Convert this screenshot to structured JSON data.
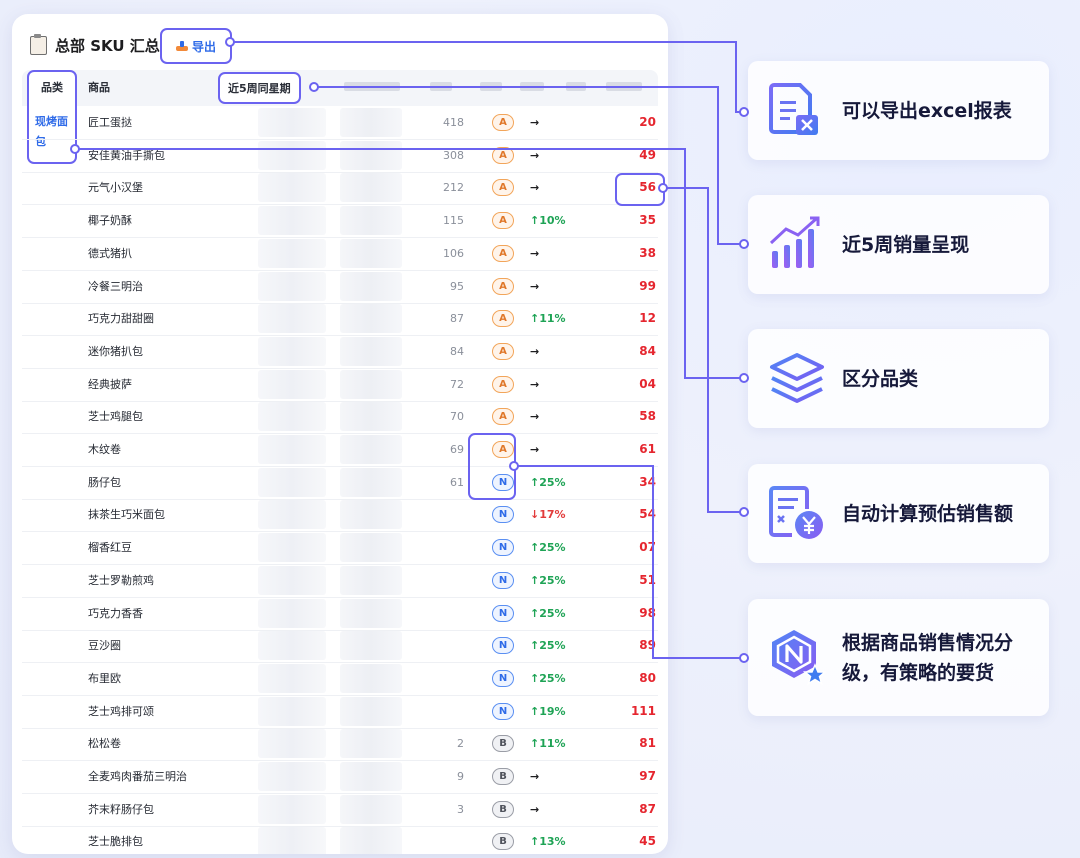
{
  "panel": {
    "title": "总部 SKU 汇总",
    "export_label": "导出",
    "headers": {
      "category": "品类",
      "product": "商品",
      "weeks": "近5周同星期"
    },
    "category_value": "现烤面包"
  },
  "rows": [
    {
      "name": "匠工蛋挞",
      "qty": "418",
      "grade": "A",
      "trend": "→",
      "trend_dir": "flat",
      "est": "20"
    },
    {
      "name": "安佳黄油手撕包",
      "qty": "308",
      "grade": "A",
      "trend": "→",
      "trend_dir": "flat",
      "est": "49"
    },
    {
      "name": "元气小汉堡",
      "qty": "212",
      "grade": "A",
      "trend": "→",
      "trend_dir": "flat",
      "est": "56"
    },
    {
      "name": "椰子奶酥",
      "qty": "115",
      "grade": "A",
      "trend": "↑10%",
      "trend_dir": "up",
      "est": "35"
    },
    {
      "name": "德式猪扒",
      "qty": "106",
      "grade": "A",
      "trend": "→",
      "trend_dir": "flat",
      "est": "38"
    },
    {
      "name": "冷餐三明治",
      "qty": "95",
      "grade": "A",
      "trend": "→",
      "trend_dir": "flat",
      "est": "99"
    },
    {
      "name": "巧克力甜甜圈",
      "qty": "87",
      "grade": "A",
      "trend": "↑11%",
      "trend_dir": "up",
      "est": "12"
    },
    {
      "name": "迷你猪扒包",
      "qty": "84",
      "grade": "A",
      "trend": "→",
      "trend_dir": "flat",
      "est": "84"
    },
    {
      "name": "经典披萨",
      "qty": "72",
      "grade": "A",
      "trend": "→",
      "trend_dir": "flat",
      "est": "04"
    },
    {
      "name": "芝士鸡腿包",
      "qty": "70",
      "grade": "A",
      "trend": "→",
      "trend_dir": "flat",
      "est": "58"
    },
    {
      "name": "木纹卷",
      "qty": "69",
      "grade": "A",
      "trend": "→",
      "trend_dir": "flat",
      "est": "61"
    },
    {
      "name": "肠仔包",
      "qty": "61",
      "grade": "N",
      "trend": "↑25%",
      "trend_dir": "up",
      "est": "34"
    },
    {
      "name": "抹茶生巧米面包",
      "qty": "",
      "grade": "N",
      "trend": "↓17%",
      "trend_dir": "down",
      "est": "54"
    },
    {
      "name": "榴香红豆",
      "qty": "",
      "grade": "N",
      "trend": "↑25%",
      "trend_dir": "up",
      "est": "07"
    },
    {
      "name": "芝士罗勒煎鸡",
      "qty": "",
      "grade": "N",
      "trend": "↑25%",
      "trend_dir": "up",
      "est": "51"
    },
    {
      "name": "巧克力香香",
      "qty": "",
      "grade": "N",
      "trend": "↑25%",
      "trend_dir": "up",
      "est": "98"
    },
    {
      "name": "豆沙圈",
      "qty": "",
      "grade": "N",
      "trend": "↑25%",
      "trend_dir": "up",
      "est": "89"
    },
    {
      "name": "布里欧",
      "qty": "",
      "grade": "N",
      "trend": "↑25%",
      "trend_dir": "up",
      "est": "80"
    },
    {
      "name": "芝士鸡排可颂",
      "qty": "",
      "grade": "N",
      "trend": "↑19%",
      "trend_dir": "up",
      "est": "111"
    },
    {
      "name": "松松卷",
      "qty": "2",
      "grade": "B",
      "trend": "↑11%",
      "trend_dir": "up",
      "est": "81"
    },
    {
      "name": "全麦鸡肉番茄三明治",
      "qty": "9",
      "grade": "B",
      "trend": "→",
      "trend_dir": "flat",
      "est": "97"
    },
    {
      "name": "芥末籽肠仔包",
      "qty": "3",
      "grade": "B",
      "trend": "→",
      "trend_dir": "flat",
      "est": "87"
    },
    {
      "name": "芝士脆排包",
      "qty": "",
      "grade": "B",
      "trend": "↑13%",
      "trend_dir": "up",
      "est": "45"
    }
  ],
  "features": [
    {
      "text": "可以导出excel报表",
      "icon": "excel-report-icon"
    },
    {
      "text": "近5周销量呈现",
      "icon": "sales-trend-chart-icon"
    },
    {
      "text": "区分品类",
      "icon": "layers-icon"
    },
    {
      "text": "自动计算预估销售额",
      "icon": "yuan-document-icon"
    },
    {
      "text": "根据商品销售情况分级，有策略的要货",
      "icon": "hexagon-n-star-icon"
    }
  ],
  "colors": {
    "accent": "#6b63f0",
    "blue": "#2f6be8",
    "red": "#e5262f",
    "green": "#1ea355",
    "orange": "#e0782a"
  }
}
